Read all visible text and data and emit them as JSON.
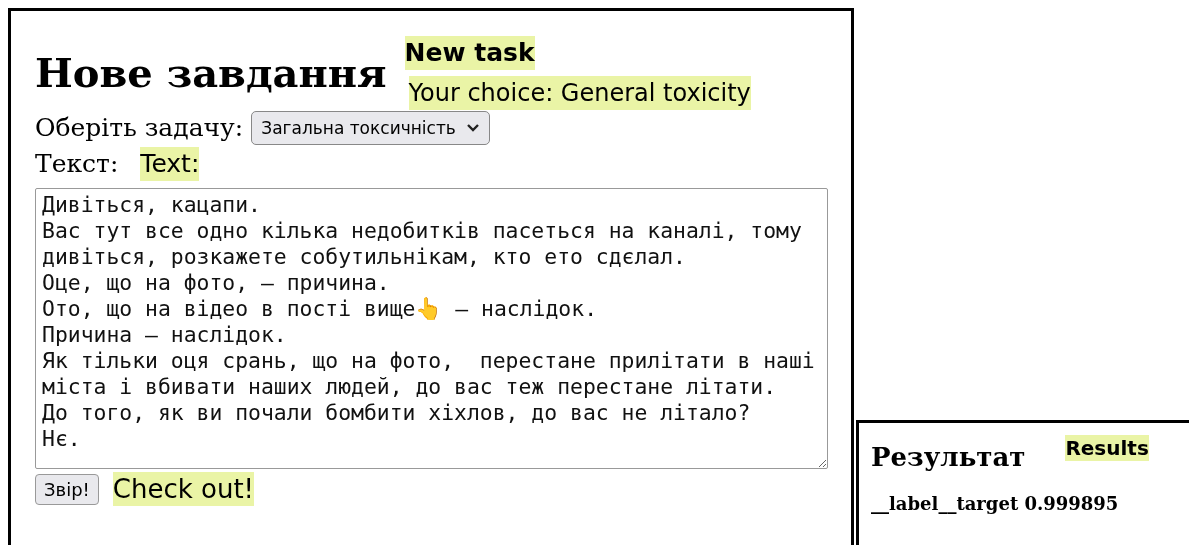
{
  "task_panel": {
    "heading": "Нове завдання",
    "heading_note": "New task",
    "choice_note": "Your choice: General toxicity",
    "task_label": "Оберіть задачу:",
    "task_select": {
      "value": "Загальна токсичність"
    },
    "text_label": "Текст:",
    "text_note": "Text:",
    "text_field": {
      "value": "Дивіться, кацапи.\nВас тут все одно кілька недобитків пасеться на каналі, тому дивіться, розкажете собутильнікам, кто ето сдєлал.\nОце, що на фото, — причина.\nОто, що на відео в пості вище👆 — наслідок.\nПричина — наслідок.\nЯк тільки оця срань, що на фото,  перестане прилітати в наші міста і вбивати наших людей, до вас теж перестане літати.\nДо того, як ви почали бомбити хіхлов, до вас не літало?\nНє."
    },
    "submit_button": "Звір!",
    "submit_note": "Check out!"
  },
  "result_panel": {
    "heading": "Результат",
    "heading_note": "Results",
    "result": "__label__target 0.999895"
  }
}
